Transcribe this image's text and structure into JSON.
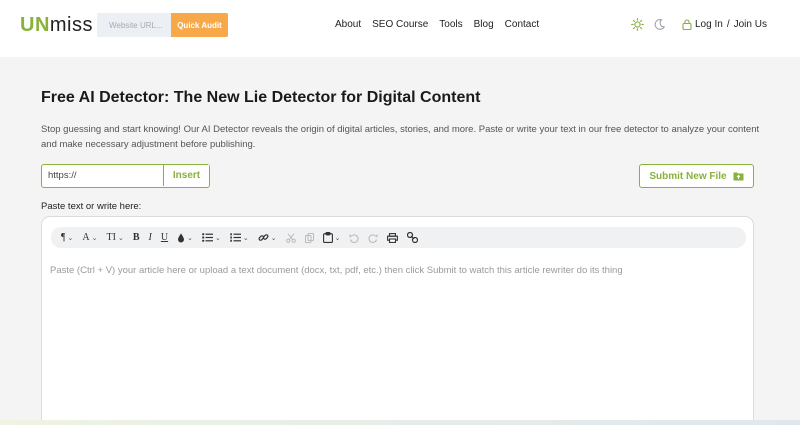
{
  "header": {
    "logo_un": "UN",
    "logo_miss": "miss",
    "search_placeholder": "Website URL...",
    "audit_label": "Quick Audit",
    "nav": [
      "About",
      "SEO Course",
      "Tools",
      "Blog",
      "Contact"
    ],
    "login": "Log In",
    "separator": "/",
    "join": "Join Us"
  },
  "main": {
    "title": "Free AI Detector: The New Lie Detector for Digital Content",
    "intro": "Stop guessing and start knowing! Our AI Detector reveals the origin of digital articles, stories, and more. Paste or write your text in our free detector to analyze your content and make necessary adjustment before publishing.",
    "url_value": "https://",
    "insert_label": "Insert",
    "submit_label": "Submit New File",
    "paste_label": "Paste text or write here:",
    "editor_placeholder": "Paste (Ctrl + V) your article here or upload a text document (docx, txt, pdf, etc.) then click Submit to watch this article rewriter do its thing"
  },
  "toolbar": {
    "paragraph": "¶",
    "font": "A",
    "textsize": "TI",
    "bold": "B",
    "italic": "I",
    "underline": "U"
  },
  "colors": {
    "accent": "#88b23a",
    "audit": "#f7a94a"
  },
  "icons": [
    "sun-icon",
    "moon-icon",
    "lock-icon",
    "file-upload-icon",
    "paragraph-icon",
    "font-icon",
    "text-size-icon",
    "bold-icon",
    "italic-icon",
    "underline-icon",
    "color-drop-icon",
    "bullet-list-icon",
    "numbered-list-icon",
    "link-icon",
    "cut-icon",
    "copy-icon",
    "paste-icon",
    "undo-icon",
    "redo-icon",
    "print-icon",
    "chain-icon"
  ]
}
